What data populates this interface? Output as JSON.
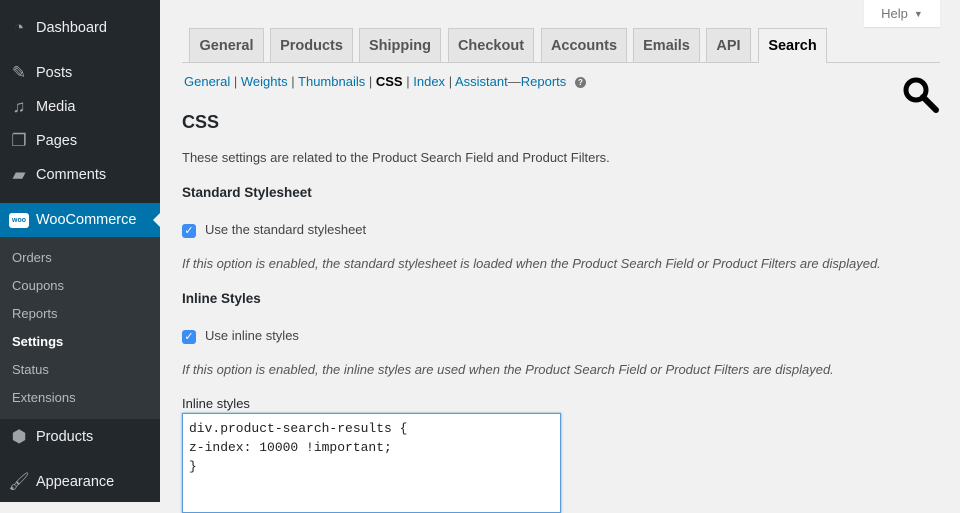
{
  "sidebar": {
    "items": [
      {
        "label": "Dashboard",
        "icon": "dashboard-icon"
      },
      {
        "label": "Posts",
        "icon": "pin-icon"
      },
      {
        "label": "Media",
        "icon": "media-icon"
      },
      {
        "label": "Pages",
        "icon": "pages-icon"
      },
      {
        "label": "Comments",
        "icon": "comment-icon"
      },
      {
        "label": "WooCommerce",
        "icon": "woo-icon",
        "logo": "woo"
      },
      {
        "label": "Products",
        "icon": "box-icon"
      },
      {
        "label": "Appearance",
        "icon": "brush-icon"
      }
    ],
    "submenu": [
      "Orders",
      "Coupons",
      "Reports",
      "Settings",
      "Status",
      "Extensions"
    ]
  },
  "help": {
    "label": "Help",
    "arrow": "▼"
  },
  "tabs": [
    "General",
    "Products",
    "Shipping",
    "Checkout",
    "Accounts",
    "Emails",
    "API",
    "Search"
  ],
  "subnav": {
    "items": [
      "General",
      "Weights",
      "Thumbnails",
      "CSS",
      "Index",
      "Assistant"
    ],
    "reports": "Reports",
    "sep": "|",
    "dash": "—",
    "help": "?"
  },
  "content": {
    "title": "CSS",
    "intro": "These settings are related to the Product Search Field and Product Filters.",
    "standard_heading": "Standard Stylesheet",
    "standard_checkbox": "Use the standard stylesheet",
    "standard_desc": "If this option is enabled, the standard stylesheet is loaded when the Product Search Field or Product Filters are displayed.",
    "inline_heading": "Inline Styles",
    "inline_checkbox": "Use inline styles",
    "inline_desc": "If this option is enabled, the inline styles are used when the Product Search Field or Product Filters are displayed.",
    "inline_label": "Inline styles",
    "inline_value": "div.product-search-results {\nz-index: 10000 !important;\n}"
  },
  "colors": {
    "accent": "#0073aa",
    "sidebar": "#23282d",
    "checkbox": "#3c8ef4"
  }
}
